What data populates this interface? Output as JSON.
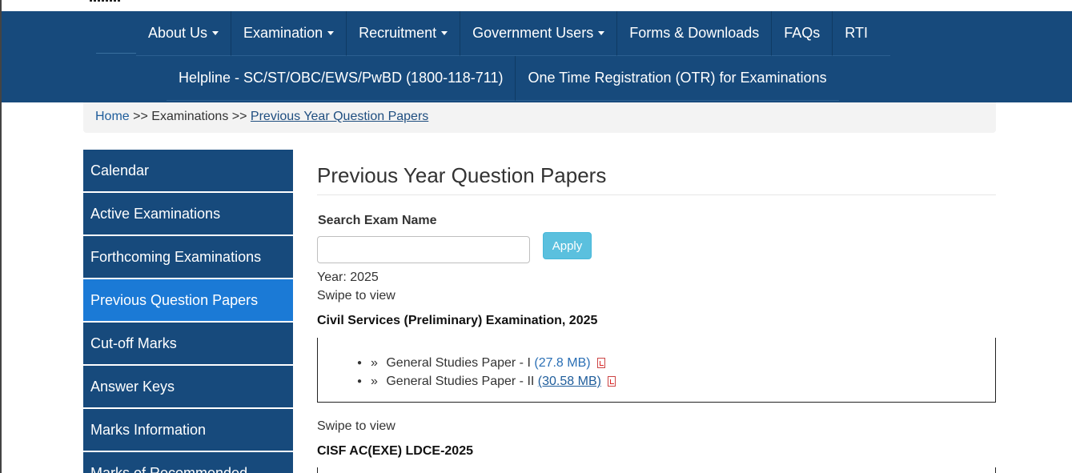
{
  "nav": {
    "row1": [
      {
        "label": "About Us",
        "dropdown": true
      },
      {
        "label": "Examination",
        "dropdown": true
      },
      {
        "label": "Recruitment",
        "dropdown": true
      },
      {
        "label": "Government Users",
        "dropdown": true
      },
      {
        "label": "Forms & Downloads",
        "dropdown": false
      },
      {
        "label": "FAQs",
        "dropdown": false
      },
      {
        "label": "RTI",
        "dropdown": false
      }
    ],
    "row2": [
      {
        "label": "Helpline - SC/ST/OBC/EWS/PwBD (1800-118-711)"
      },
      {
        "label": "One Time Registration (OTR) for Examinations"
      }
    ]
  },
  "breadcrumb": {
    "home": "Home",
    "sep1": ">>",
    "middle": "Examinations",
    "sep2": ">>",
    "current": "Previous Year Question Papers"
  },
  "sidebar": {
    "items": [
      {
        "label": "Calendar",
        "active": false
      },
      {
        "label": "Active Examinations",
        "active": false
      },
      {
        "label": "Forthcoming Examinations",
        "active": false
      },
      {
        "label": "Previous Question Papers",
        "active": true
      },
      {
        "label": "Cut-off Marks",
        "active": false
      },
      {
        "label": "Answer Keys",
        "active": false
      },
      {
        "label": "Marks Information",
        "active": false
      },
      {
        "label": "Marks of Recommended",
        "active": false
      }
    ]
  },
  "main": {
    "title": "Previous Year Question Papers",
    "search": {
      "label": "Search Exam Name",
      "value": "",
      "placeholder": ""
    },
    "apply_label": "Apply",
    "year_label": "Year: 2025",
    "swipe_label": "Swipe to view",
    "exams": [
      {
        "title": "Civil Services (Preliminary) Examination, 2025",
        "papers": [
          {
            "name": "General Studies Paper - I",
            "size": "(27.8 MB)"
          },
          {
            "name": "General Studies Paper - II",
            "size": "(30.58 MB)"
          }
        ]
      },
      {
        "title": "CISF AC(EXE) LDCE-2025",
        "papers": []
      }
    ]
  },
  "colors": {
    "navy": "#174a7c",
    "active_blue": "#1b7ad6",
    "apply_cyan": "#5bc0de",
    "link_blue": "#2a6fb5"
  },
  "icons": {
    "dropdown": "caret-down-icon",
    "pdf": "pdf-file-icon",
    "list_marker": "raquo-bullet-icon"
  }
}
